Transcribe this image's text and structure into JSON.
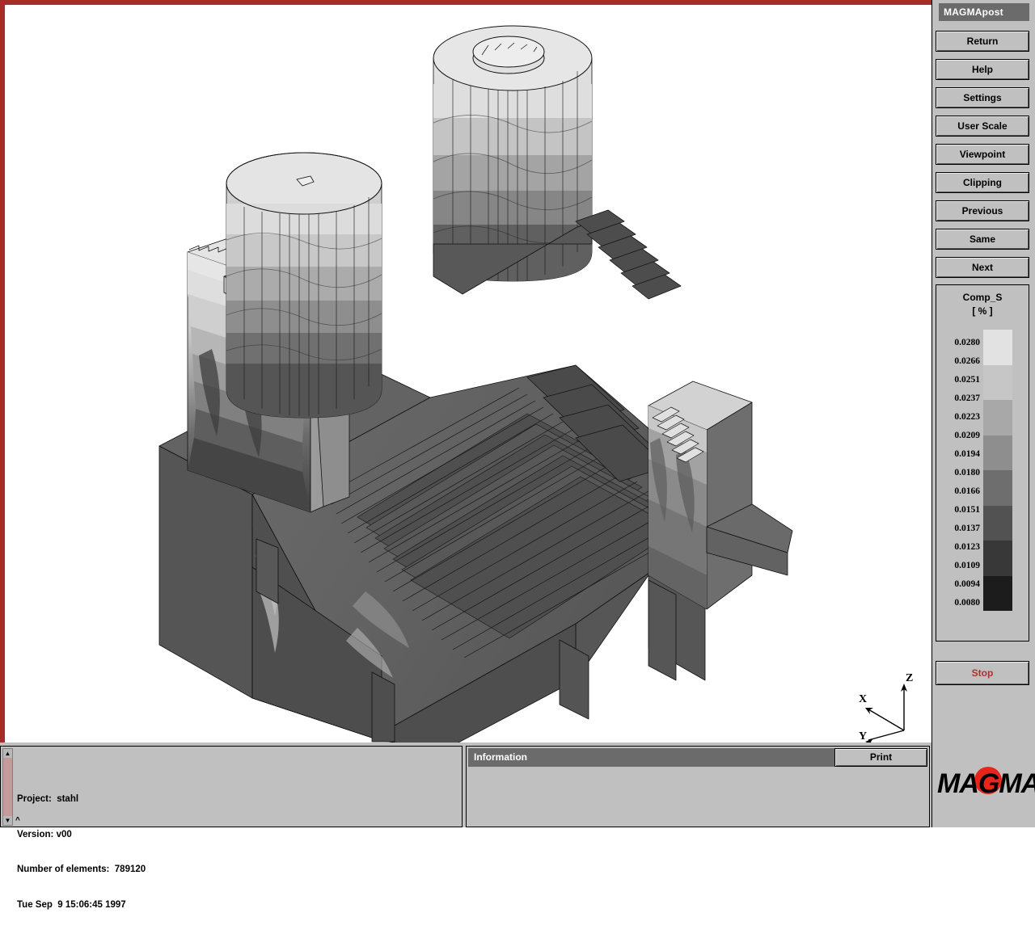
{
  "window": {
    "title": "MAGMApost"
  },
  "colors": {
    "frame_red": "#a82b2b",
    "panel_gray": "#c0c0c0",
    "header_gray": "#6b6b6b",
    "stop_red": "#b03030",
    "logo_red": "#e8251c"
  },
  "toolbar": {
    "buttons": [
      {
        "label": "Return",
        "name": "return-button"
      },
      {
        "label": "Help",
        "name": "help-button"
      },
      {
        "label": "Settings",
        "name": "settings-button"
      },
      {
        "label": "User Scale",
        "name": "user-scale-button"
      },
      {
        "label": "Viewpoint",
        "name": "viewpoint-button"
      },
      {
        "label": "Clipping",
        "name": "clipping-button"
      },
      {
        "label": "Previous",
        "name": "previous-button"
      },
      {
        "label": "Same",
        "name": "same-button"
      },
      {
        "label": "Next",
        "name": "next-button"
      }
    ],
    "stop_label": "Stop"
  },
  "legend": {
    "title": "Comp_S",
    "unit": "[ % ]",
    "values": [
      "0.0280",
      "0.0266",
      "0.0251",
      "0.0237",
      "0.0223",
      "0.0209",
      "0.0194",
      "0.0180",
      "0.0166",
      "0.0151",
      "0.0137",
      "0.0123",
      "0.0109",
      "0.0094",
      "0.0080"
    ],
    "swatch_colors": [
      "#e2e2e2",
      "#c6c6c6",
      "#a8a8a8",
      "#8e8e8e",
      "#6e6e6e",
      "#525252",
      "#383838",
      "#1c1c1c"
    ]
  },
  "project": {
    "line1": "Project:  stahl",
    "line2": "Version: v00",
    "line3": "Number of elements:  789120",
    "line4": "Tue Sep  9 15:06:45 1997",
    "caret": "^"
  },
  "information": {
    "label": "Information",
    "print_label": "Print"
  },
  "logo": {
    "text": "MAGMA"
  },
  "axes": {
    "x": "X",
    "y": "Y",
    "z": "Z"
  },
  "chart_data": {
    "type": "heatmap",
    "title": "Comp_S",
    "unit": "[ % ]",
    "description": "3D casting solidification simulation result rendered as a shaded contour (iso-band) view of a voxelized mould/casting geometry with two risers and a ribbed base plate.",
    "scale_labels": [
      "0.0280",
      "0.0266",
      "0.0251",
      "0.0237",
      "0.0223",
      "0.0209",
      "0.0194",
      "0.0180",
      "0.0166",
      "0.0151",
      "0.0137",
      "0.0123",
      "0.0109",
      "0.0094",
      "0.0080"
    ],
    "scale_values": [
      0.028,
      0.0266,
      0.0251,
      0.0237,
      0.0223,
      0.0209,
      0.0194,
      0.018,
      0.0166,
      0.0151,
      0.0137,
      0.0123,
      0.0109,
      0.0094,
      0.008
    ],
    "range": [
      0.008,
      0.028
    ],
    "band_colors": [
      "#e2e2e2",
      "#c6c6c6",
      "#a8a8a8",
      "#8e8e8e",
      "#6e6e6e",
      "#525252",
      "#383838",
      "#1c1c1c"
    ],
    "legend_position": "right",
    "grid": false
  }
}
